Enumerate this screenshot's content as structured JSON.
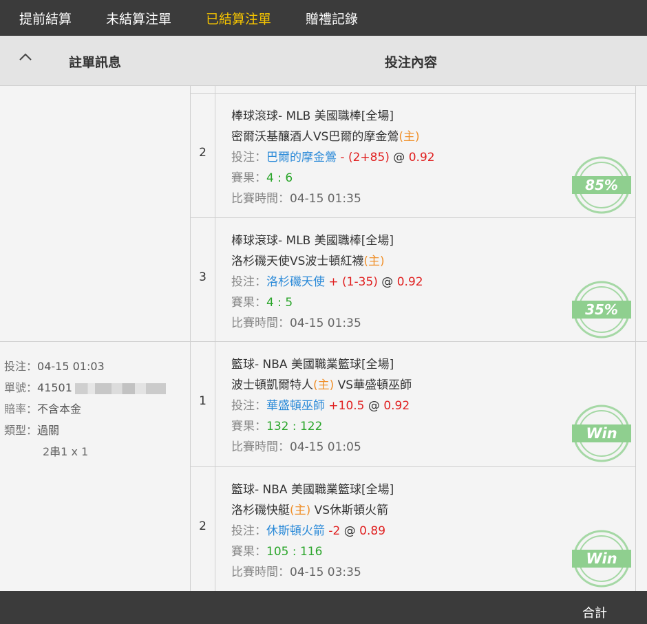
{
  "nav": {
    "tabs": [
      {
        "label": "提前結算",
        "active": false
      },
      {
        "label": "未結算注單",
        "active": false
      },
      {
        "label": "已結算注單",
        "active": true
      },
      {
        "label": "贈禮記錄",
        "active": false
      }
    ]
  },
  "header": {
    "col_left": "註單訊息",
    "col_right": "投注內容"
  },
  "bet_info": {
    "time_label": "投注：",
    "time_value": "04-15 01:03",
    "id_label": "單號：",
    "id_value": "41501",
    "odds_label": "賠率：",
    "odds_value": "不含本金",
    "type_label": "類型：",
    "type_value": "過關",
    "type_detail": "2串1 x 1"
  },
  "legs": [
    {
      "index": "2",
      "league": "棒球滾球- MLB 美國職棒[全場]",
      "home_team": "密爾沃基釀酒人",
      "vs": "VS",
      "away_team": "巴爾的摩金鶯",
      "home_marker": "(主)",
      "pick_label": "投注：",
      "pick": "巴爾的摩金鶯",
      "handicap": " - (2+85)",
      "at": " @ ",
      "odds": "0.92",
      "result_label": "賽果：",
      "result": "4 : 6",
      "time_label": "比賽時間：",
      "time": "04-15 01:35",
      "badge": "85%"
    },
    {
      "index": "3",
      "league": "棒球滾球- MLB 美國職棒[全場]",
      "home_team": "洛杉磯天使",
      "vs": "VS",
      "away_team": "波士頓紅襪",
      "home_marker": "(主)",
      "pick_label": "投注：",
      "pick": "洛杉磯天使",
      "handicap": " + (1-35)",
      "at": " @ ",
      "odds": "0.92",
      "result_label": "賽果：",
      "result": "4 : 5",
      "time_label": "比賽時間：",
      "time": "04-15 01:35",
      "badge": "35%"
    },
    {
      "index": "1",
      "league": "籃球- NBA 美國職業籃球[全場]",
      "home_team": "波士頓凱爾特人",
      "home_marker": "(主)",
      "vs": " VS",
      "away_team": "華盛頓巫師",
      "pick_label": "投注：",
      "pick": "華盛頓巫師",
      "handicap": " +10.5",
      "at": " @ ",
      "odds": "0.92",
      "result_label": "賽果：",
      "result": "132 : 122",
      "time_label": "比賽時間：",
      "time": "04-15 01:05",
      "badge": "Win"
    },
    {
      "index": "2",
      "league": "籃球- NBA 美國職業籃球[全場]",
      "home_team": "洛杉磯快艇",
      "home_marker": "(主)",
      "vs": " VS",
      "away_team": "休斯頓火箭",
      "pick_label": "投注：",
      "pick": "休斯頓火箭",
      "handicap": " -2",
      "at": " @ ",
      "odds": "0.89",
      "result_label": "賽果：",
      "result": "105 : 116",
      "time_label": "比賽時間：",
      "time": "04-15 03:35",
      "badge": "Win"
    }
  ],
  "footer": {
    "total_label": "合計"
  },
  "colors": {
    "nav_bg": "#3b3b3b",
    "active_tab": "#f5c400",
    "pick_blue": "#2b8ad8",
    "odds_red": "#e02020",
    "home_orange": "#f0902a",
    "result_green": "#2aa52a",
    "badge_green": "#8fcf8f"
  }
}
